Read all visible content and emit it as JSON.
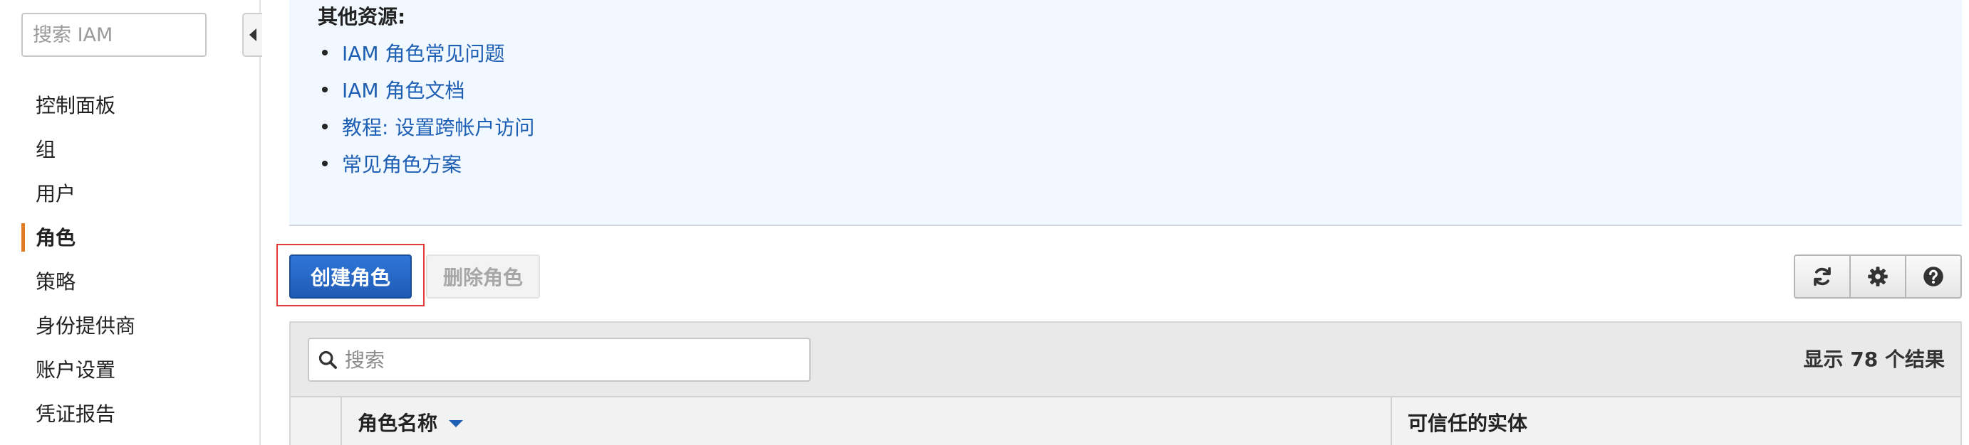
{
  "sidebar": {
    "search_placeholder": "搜索 IAM",
    "items": [
      {
        "label": "控制面板"
      },
      {
        "label": "组"
      },
      {
        "label": "用户"
      },
      {
        "label": "角色"
      },
      {
        "label": "策略"
      },
      {
        "label": "身份提供商"
      },
      {
        "label": "账户设置"
      },
      {
        "label": "凭证报告"
      }
    ],
    "active_item": "角色"
  },
  "resources": {
    "title": "其他资源:",
    "links": [
      {
        "label": "IAM 角色常见问题"
      },
      {
        "label": "IAM 角色文档"
      },
      {
        "label": "教程: 设置跨帐户访问"
      },
      {
        "label": "常见角色方案"
      }
    ]
  },
  "toolbar": {
    "create_label": "创建角色",
    "delete_label": "删除角色",
    "icons": [
      "refresh-icon",
      "gear-icon",
      "help-icon"
    ]
  },
  "table": {
    "search_placeholder": "搜索",
    "result_count": "显示 78 个结果",
    "columns": {
      "name": "角色名称",
      "trusted": "可信任的实体"
    }
  },
  "colors": {
    "accent_primary": "#2f76d8",
    "active_indicator": "#e07b24",
    "link": "#1e5fb4",
    "info_bg": "#f1f8ff",
    "highlight": "#e23b3b"
  }
}
